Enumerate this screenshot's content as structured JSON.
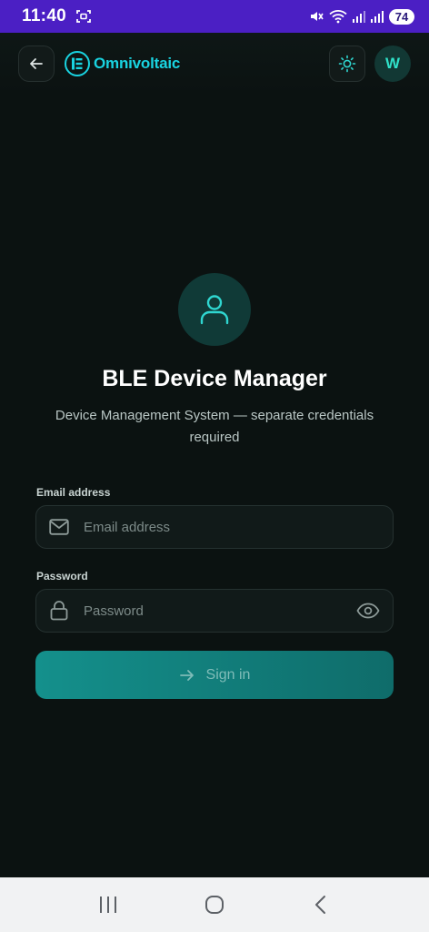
{
  "status_bar": {
    "time": "11:40",
    "battery": "74",
    "icons": [
      "screenshot-icon",
      "mute-icon",
      "wifi-icon",
      "signal-icon",
      "signal-icon"
    ]
  },
  "header": {
    "brand_name": "Omnivoltaic",
    "avatar_initial": "W",
    "icons": [
      "back-arrow-icon",
      "brand-logo-icon",
      "sun-icon"
    ]
  },
  "main": {
    "title": "BLE Device Manager",
    "subtitle": "Device Management System — separate credentials required",
    "email": {
      "label": "Email address",
      "placeholder": "Email address",
      "value": ""
    },
    "password": {
      "label": "Password",
      "placeholder": "Password",
      "value": ""
    },
    "signin_label": "Sign in"
  },
  "colors": {
    "accent": "#19d3e0",
    "background": "#0b1211",
    "button": "#14908c",
    "status_bar": "#4b1fc4"
  },
  "nav_bar": {
    "icons": [
      "recent-apps-icon",
      "home-icon",
      "back-icon"
    ]
  }
}
